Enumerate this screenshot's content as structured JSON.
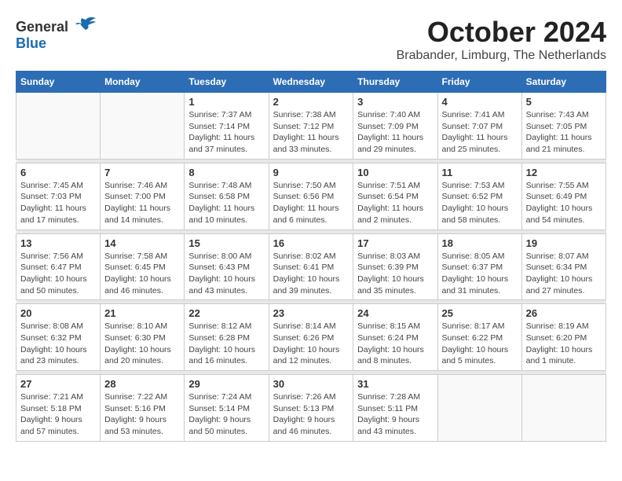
{
  "header": {
    "logo_general": "General",
    "logo_blue": "Blue",
    "month": "October 2024",
    "location": "Brabander, Limburg, The Netherlands"
  },
  "days_of_week": [
    "Sunday",
    "Monday",
    "Tuesday",
    "Wednesday",
    "Thursday",
    "Friday",
    "Saturday"
  ],
  "weeks": [
    [
      {
        "day": "",
        "info": ""
      },
      {
        "day": "",
        "info": ""
      },
      {
        "day": "1",
        "info": "Sunrise: 7:37 AM\nSunset: 7:14 PM\nDaylight: 11 hours and 37 minutes."
      },
      {
        "day": "2",
        "info": "Sunrise: 7:38 AM\nSunset: 7:12 PM\nDaylight: 11 hours and 33 minutes."
      },
      {
        "day": "3",
        "info": "Sunrise: 7:40 AM\nSunset: 7:09 PM\nDaylight: 11 hours and 29 minutes."
      },
      {
        "day": "4",
        "info": "Sunrise: 7:41 AM\nSunset: 7:07 PM\nDaylight: 11 hours and 25 minutes."
      },
      {
        "day": "5",
        "info": "Sunrise: 7:43 AM\nSunset: 7:05 PM\nDaylight: 11 hours and 21 minutes."
      }
    ],
    [
      {
        "day": "6",
        "info": "Sunrise: 7:45 AM\nSunset: 7:03 PM\nDaylight: 11 hours and 17 minutes."
      },
      {
        "day": "7",
        "info": "Sunrise: 7:46 AM\nSunset: 7:00 PM\nDaylight: 11 hours and 14 minutes."
      },
      {
        "day": "8",
        "info": "Sunrise: 7:48 AM\nSunset: 6:58 PM\nDaylight: 11 hours and 10 minutes."
      },
      {
        "day": "9",
        "info": "Sunrise: 7:50 AM\nSunset: 6:56 PM\nDaylight: 11 hours and 6 minutes."
      },
      {
        "day": "10",
        "info": "Sunrise: 7:51 AM\nSunset: 6:54 PM\nDaylight: 11 hours and 2 minutes."
      },
      {
        "day": "11",
        "info": "Sunrise: 7:53 AM\nSunset: 6:52 PM\nDaylight: 10 hours and 58 minutes."
      },
      {
        "day": "12",
        "info": "Sunrise: 7:55 AM\nSunset: 6:49 PM\nDaylight: 10 hours and 54 minutes."
      }
    ],
    [
      {
        "day": "13",
        "info": "Sunrise: 7:56 AM\nSunset: 6:47 PM\nDaylight: 10 hours and 50 minutes."
      },
      {
        "day": "14",
        "info": "Sunrise: 7:58 AM\nSunset: 6:45 PM\nDaylight: 10 hours and 46 minutes."
      },
      {
        "day": "15",
        "info": "Sunrise: 8:00 AM\nSunset: 6:43 PM\nDaylight: 10 hours and 43 minutes."
      },
      {
        "day": "16",
        "info": "Sunrise: 8:02 AM\nSunset: 6:41 PM\nDaylight: 10 hours and 39 minutes."
      },
      {
        "day": "17",
        "info": "Sunrise: 8:03 AM\nSunset: 6:39 PM\nDaylight: 10 hours and 35 minutes."
      },
      {
        "day": "18",
        "info": "Sunrise: 8:05 AM\nSunset: 6:37 PM\nDaylight: 10 hours and 31 minutes."
      },
      {
        "day": "19",
        "info": "Sunrise: 8:07 AM\nSunset: 6:34 PM\nDaylight: 10 hours and 27 minutes."
      }
    ],
    [
      {
        "day": "20",
        "info": "Sunrise: 8:08 AM\nSunset: 6:32 PM\nDaylight: 10 hours and 23 minutes."
      },
      {
        "day": "21",
        "info": "Sunrise: 8:10 AM\nSunset: 6:30 PM\nDaylight: 10 hours and 20 minutes."
      },
      {
        "day": "22",
        "info": "Sunrise: 8:12 AM\nSunset: 6:28 PM\nDaylight: 10 hours and 16 minutes."
      },
      {
        "day": "23",
        "info": "Sunrise: 8:14 AM\nSunset: 6:26 PM\nDaylight: 10 hours and 12 minutes."
      },
      {
        "day": "24",
        "info": "Sunrise: 8:15 AM\nSunset: 6:24 PM\nDaylight: 10 hours and 8 minutes."
      },
      {
        "day": "25",
        "info": "Sunrise: 8:17 AM\nSunset: 6:22 PM\nDaylight: 10 hours and 5 minutes."
      },
      {
        "day": "26",
        "info": "Sunrise: 8:19 AM\nSunset: 6:20 PM\nDaylight: 10 hours and 1 minute."
      }
    ],
    [
      {
        "day": "27",
        "info": "Sunrise: 7:21 AM\nSunset: 5:18 PM\nDaylight: 9 hours and 57 minutes."
      },
      {
        "day": "28",
        "info": "Sunrise: 7:22 AM\nSunset: 5:16 PM\nDaylight: 9 hours and 53 minutes."
      },
      {
        "day": "29",
        "info": "Sunrise: 7:24 AM\nSunset: 5:14 PM\nDaylight: 9 hours and 50 minutes."
      },
      {
        "day": "30",
        "info": "Sunrise: 7:26 AM\nSunset: 5:13 PM\nDaylight: 9 hours and 46 minutes."
      },
      {
        "day": "31",
        "info": "Sunrise: 7:28 AM\nSunset: 5:11 PM\nDaylight: 9 hours and 43 minutes."
      },
      {
        "day": "",
        "info": ""
      },
      {
        "day": "",
        "info": ""
      }
    ]
  ]
}
